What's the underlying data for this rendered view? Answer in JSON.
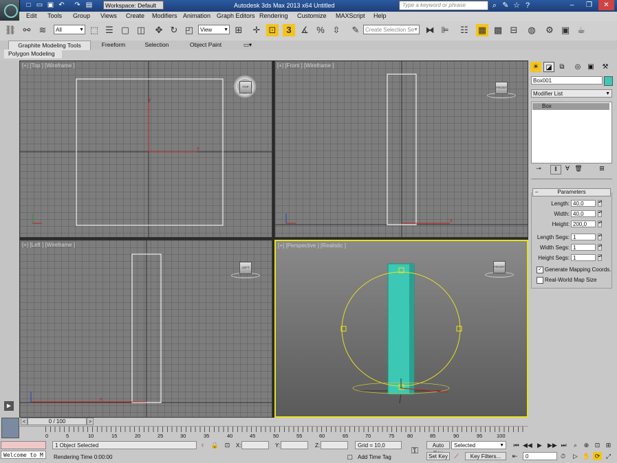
{
  "titlebar": {
    "workspace": "Workspace: Default",
    "app_title": "Autodesk 3ds Max  2013 x64",
    "doc_title": "Untitled",
    "search_placeholder": "Type a keyword or phrase"
  },
  "menu": [
    "Edit",
    "Tools",
    "Group",
    "Views",
    "Create",
    "Modifiers",
    "Animation",
    "Graph Editors",
    "Rendering",
    "Customize",
    "MAXScript",
    "Help"
  ],
  "toolbar": {
    "selection_filter": "All",
    "ref_coord": "View",
    "named_selection_placeholder": "Create Selection Se",
    "snap_number": "3"
  },
  "ribbon": {
    "tabs": [
      "Graphite Modeling Tools",
      "Freeform",
      "Selection",
      "Object Paint"
    ],
    "subtab": "Polygon Modeling"
  },
  "viewports": {
    "top": "[+] [Top ] [Wireframe ]",
    "front": "[+] [Front ] [Wireframe ]",
    "left": "[+] [Left ] [Wireframe ]",
    "perspective": "[+] [Perspective ] [Realistic ]",
    "cube_top": "TOP",
    "cube_front": "FRONT",
    "cube_left": "LEFT"
  },
  "command_panel": {
    "object_name": "Box001",
    "object_color": "#3cc8b4",
    "modifier_list": "Modifier List",
    "stack_item": "Box",
    "rollout_title": "Parameters",
    "params": [
      {
        "label": "Length:",
        "value": "40,0"
      },
      {
        "label": "Width:",
        "value": "40,0"
      },
      {
        "label": "Height:",
        "value": "200,0"
      }
    ],
    "segs": [
      {
        "label": "Length Segs:",
        "value": "1"
      },
      {
        "label": "Width Segs:",
        "value": "1"
      },
      {
        "label": "Height Segs:",
        "value": "1"
      }
    ],
    "gen_mapping": "Generate Mapping Coords.",
    "real_world": "Real-World Map Size"
  },
  "timeline": {
    "frame": "0 / 100",
    "ticks": [
      "0",
      "5",
      "10",
      "15",
      "20",
      "25",
      "30",
      "35",
      "40",
      "45",
      "50",
      "55",
      "60",
      "65",
      "70",
      "75",
      "80",
      "85",
      "90",
      "95",
      "100"
    ]
  },
  "status": {
    "maxscript": "Welcome to M",
    "selection": "1 Object Selected",
    "rendering_time": "Rendering Time  0:00:00",
    "x_label": "X:",
    "y_label": "Y:",
    "z_label": "Z:",
    "grid": "Grid = 10,0",
    "add_time_tag": "Add Time Tag",
    "auto_key": "Auto Key",
    "set_key": "Set Key",
    "selected": "Selected",
    "key_filters": "Key Filters...",
    "current_frame": "0"
  }
}
